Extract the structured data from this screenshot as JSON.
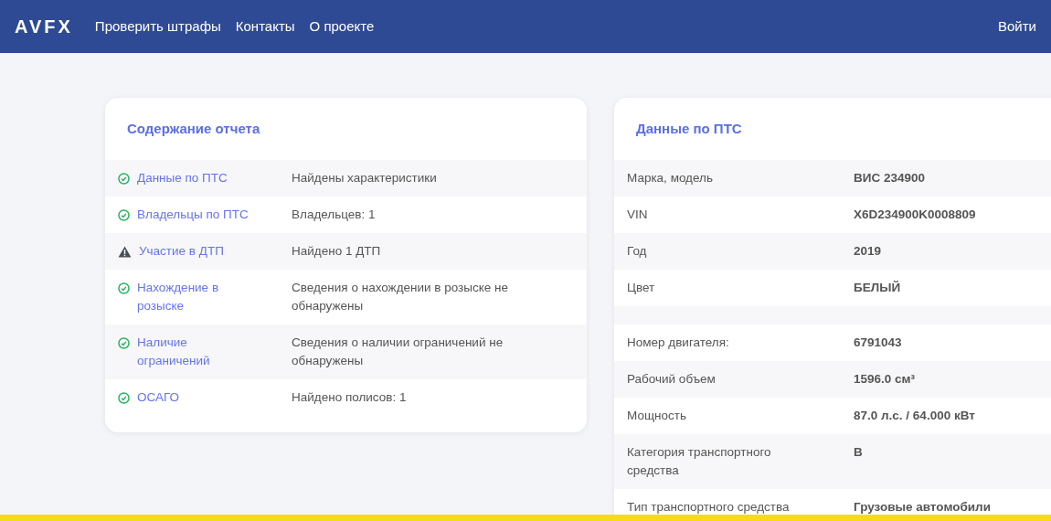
{
  "navbar": {
    "logo": "AVFX",
    "links": [
      "Проверить штрафы",
      "Контакты",
      "О проекте"
    ],
    "login": "Войти"
  },
  "report_contents": {
    "title": "Содержание отчета",
    "items": [
      {
        "kind": "ok",
        "label": "Данные по ПТС",
        "result": "Найдены характеристики"
      },
      {
        "kind": "ok",
        "label": "Владельцы по ПТС",
        "result": "Владельцев: 1"
      },
      {
        "kind": "warning",
        "label": "Участие в ДТП",
        "result": "Найдено 1 ДТП"
      },
      {
        "kind": "ok",
        "label": "Нахождение в розыске",
        "result": "Сведения о нахождении в розыске не обнаружены"
      },
      {
        "kind": "ok",
        "label": "Наличие ограничений",
        "result": "Сведения о наличии ограничений не обнаружены"
      },
      {
        "kind": "ok",
        "label": "ОСАГО",
        "result": "Найдено полисов: 1"
      }
    ]
  },
  "vehicle_data": {
    "title": "Данные по ПТС",
    "rows": [
      {
        "kind": "field",
        "label": "Марка, модель",
        "value": "ВИС 234900"
      },
      {
        "kind": "field",
        "label": "VIN",
        "value": "X6D234900K0008809"
      },
      {
        "kind": "field",
        "label": "Год",
        "value": "2019"
      },
      {
        "kind": "field",
        "label": "Цвет",
        "value": "БЕЛЫЙ"
      },
      {
        "kind": "spacer"
      },
      {
        "kind": "field",
        "label": "Номер двигателя:",
        "value": "6791043"
      },
      {
        "kind": "field",
        "label": "Рабочий объем",
        "value": "1596.0 см³"
      },
      {
        "kind": "field",
        "label": "Мощность",
        "value": "87.0 л.с. / 64.000 кВт"
      },
      {
        "kind": "field",
        "label": "Категория транспортного средства",
        "value": "B"
      },
      {
        "kind": "field",
        "label": "Тип транспортного средства",
        "value": "Грузовые автомобили"
      }
    ]
  }
}
